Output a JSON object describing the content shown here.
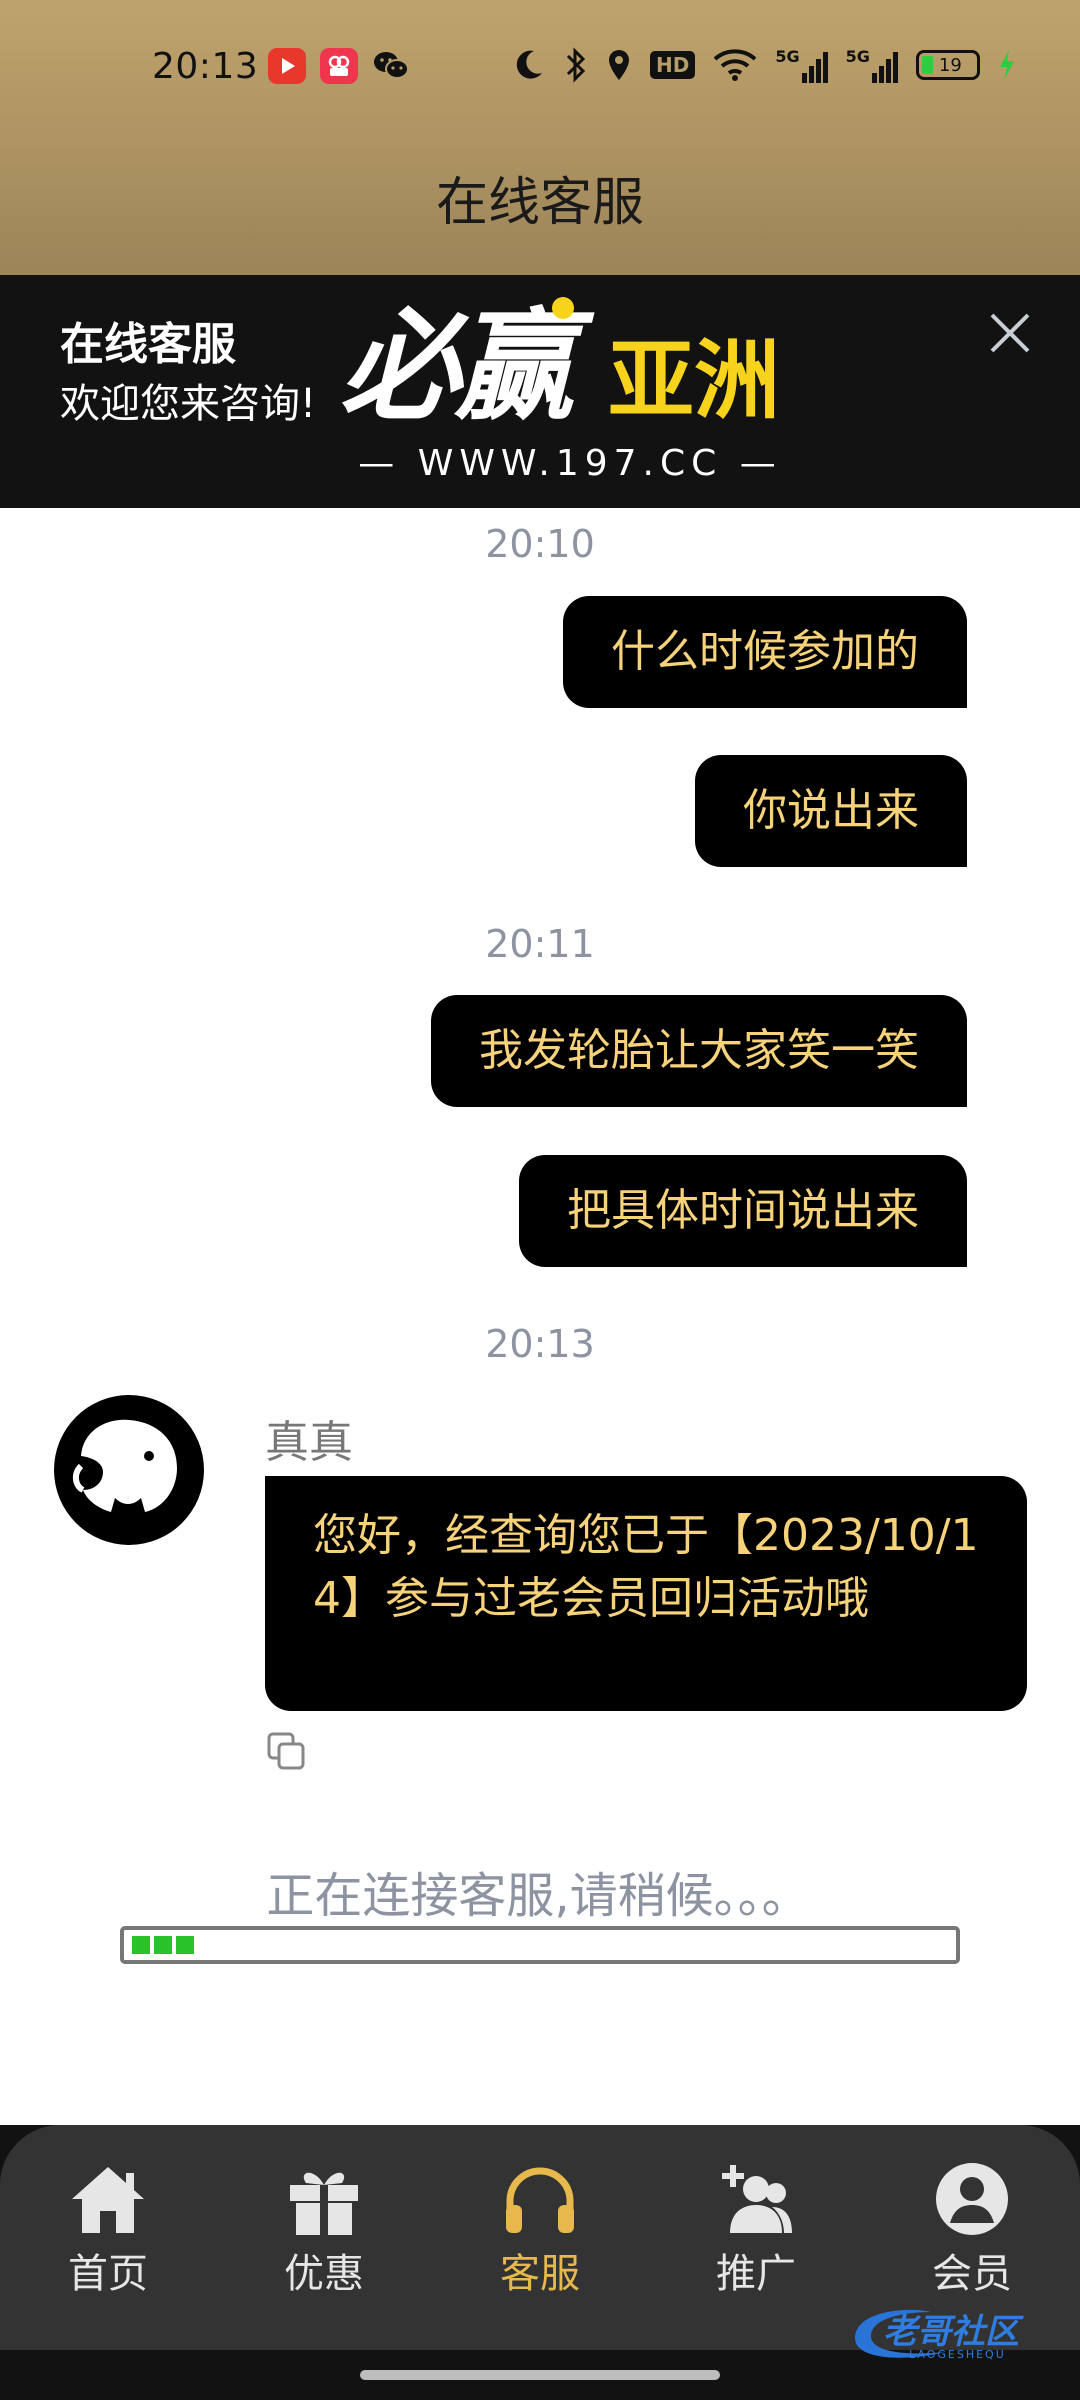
{
  "status_bar": {
    "time": "20:13",
    "battery": "19",
    "network_1": "5G",
    "network_2": "5G",
    "hd_badge": "HD",
    "left_icons": [
      "video-app-icon",
      "camera-app-icon",
      "wechat-icon"
    ],
    "right_icons": [
      "moon-icon",
      "bluetooth-icon",
      "location-icon",
      "hd-icon",
      "wifi-icon",
      "signal-icon",
      "signal-icon",
      "battery-icon",
      "charging-icon"
    ]
  },
  "header": {
    "title": "在线客服"
  },
  "banner": {
    "title": "在线客服",
    "subtitle": "欢迎您来咨询!",
    "logo_main": "必赢",
    "logo_accent": "亚洲",
    "logo_url": "— WWW.197.CC —",
    "close_icon": "close-icon",
    "accent_color": "#f7d41b"
  },
  "chat": {
    "timestamps": [
      "20:10",
      "20:11",
      "20:13"
    ],
    "user_messages": [
      "什么时候参加的",
      "你说出来",
      "我发轮胎让大家笑一笑",
      "把具体时间说出来"
    ],
    "agent": {
      "name": "真真",
      "message": "您好，经查询您已于【2023/10/14】参与过老会员回归活动哦",
      "copy_icon": "copy-icon"
    },
    "status_text": "正在连接客服,请稍候。。。",
    "progress_fraction": 0.05
  },
  "nav": {
    "items": [
      {
        "label": "首页",
        "icon": "home-icon"
      },
      {
        "label": "优惠",
        "icon": "gift-icon"
      },
      {
        "label": "客服",
        "icon": "headphones-icon"
      },
      {
        "label": "推广",
        "icon": "add-user-icon"
      },
      {
        "label": "会员",
        "icon": "user-icon"
      }
    ],
    "active_index": 2,
    "active_color": "#e7b84c"
  },
  "watermark": {
    "text": "老哥社区",
    "subtext": "LAOGESHEQU"
  }
}
